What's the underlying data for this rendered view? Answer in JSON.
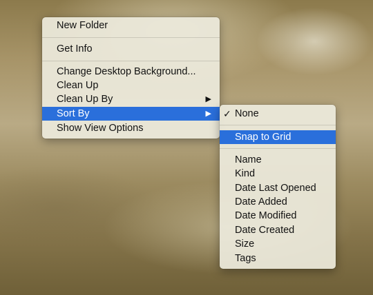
{
  "context_menu": {
    "items": [
      {
        "label": "New Folder"
      },
      {
        "label": "Get Info"
      },
      {
        "label": "Change Desktop Background..."
      },
      {
        "label": "Clean Up"
      },
      {
        "label": "Clean Up By",
        "submenu_icon": "chevron-right-icon"
      },
      {
        "label": "Sort By",
        "submenu_icon": "chevron-right-icon",
        "highlighted": true
      },
      {
        "label": "Show View Options"
      }
    ]
  },
  "sort_submenu": {
    "checkmark": "✓",
    "items": [
      {
        "label": "None",
        "checked": true
      },
      {
        "label": "Snap to Grid",
        "highlighted": true
      },
      {
        "label": "Name"
      },
      {
        "label": "Kind"
      },
      {
        "label": "Date Last Opened"
      },
      {
        "label": "Date Added"
      },
      {
        "label": "Date Modified"
      },
      {
        "label": "Date Created"
      },
      {
        "label": "Size"
      },
      {
        "label": "Tags"
      }
    ]
  },
  "colors": {
    "highlight": "#2a6fdb",
    "menu_background": "#ece9dc"
  }
}
